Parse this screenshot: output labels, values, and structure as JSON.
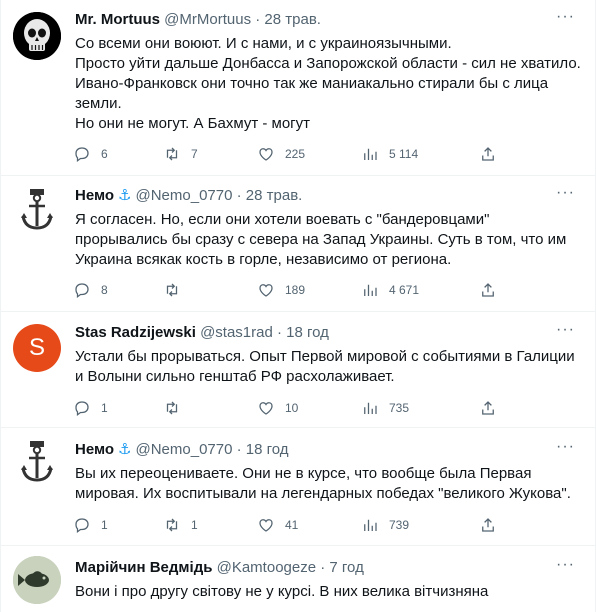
{
  "tweets": [
    {
      "name": "Mr. Mortuus",
      "handle": "@MrMortuus",
      "time": "28 трав.",
      "lines": [
        "Со всеми они воюют. И с нами, и с украиноязычными.",
        "Просто уйти дальше Донбасса и Запорожской области - сил не хватило.",
        "Ивано-Франковск они точно так же маниакально стирали бы с лица",
        "земли.",
        "Но они не могут. А Бахмут - могут"
      ],
      "replies": "6",
      "retweets": "7",
      "likes": "225",
      "views": "5 114"
    },
    {
      "name": "Немо",
      "badge": "⚓",
      "handle": "@Nemo_0770",
      "time": "28 трав.",
      "lines": [
        "Я согласен. Но, если они хотели воевать с \"бандеровцами\"",
        "прорывались бы сразу с севера на Запад Украины. Суть в том, что им",
        "Украина всякак кость в горле, независимо от региона."
      ],
      "replies": "8",
      "retweets": "",
      "likes": "189",
      "views": "4 671"
    },
    {
      "name": "Stas Radzijewski",
      "avatar_letter": "S",
      "handle": "@stas1rad",
      "time": "18 год",
      "lines": [
        "Устали бы прорываться. Опыт Первой мировой с событиями в Галиции",
        "и Волыни сильно генштаб РФ расхолаживает."
      ],
      "replies": "1",
      "retweets": "",
      "likes": "10",
      "views": "735"
    },
    {
      "name": "Немо",
      "badge": "⚓",
      "handle": "@Nemo_0770",
      "time": "18 год",
      "lines": [
        "Вы их переоцениваете. Они не в курсе, что вообще была Первая",
        "мировая. Их воспитывали на легендарных победах \"великого Жукова\"."
      ],
      "replies": "1",
      "retweets": "1",
      "likes": "41",
      "views": "739"
    },
    {
      "name": "Марійчин Ведмідь",
      "handle": "@Kamtoogeze",
      "time": "7 год",
      "lines": [
        "Вони і про другу світову не у курсі.  В них велика вітчизняна"
      ]
    }
  ],
  "icons": {
    "reply": "reply-icon",
    "retweet": "retweet-icon",
    "like": "heart-icon",
    "views": "views-icon",
    "share": "share-icon",
    "more": "more-icon"
  },
  "colors": {
    "text": "#0f1419",
    "secondary": "#536471",
    "accent": "#1d9bf0",
    "divider": "#eff3f4"
  }
}
